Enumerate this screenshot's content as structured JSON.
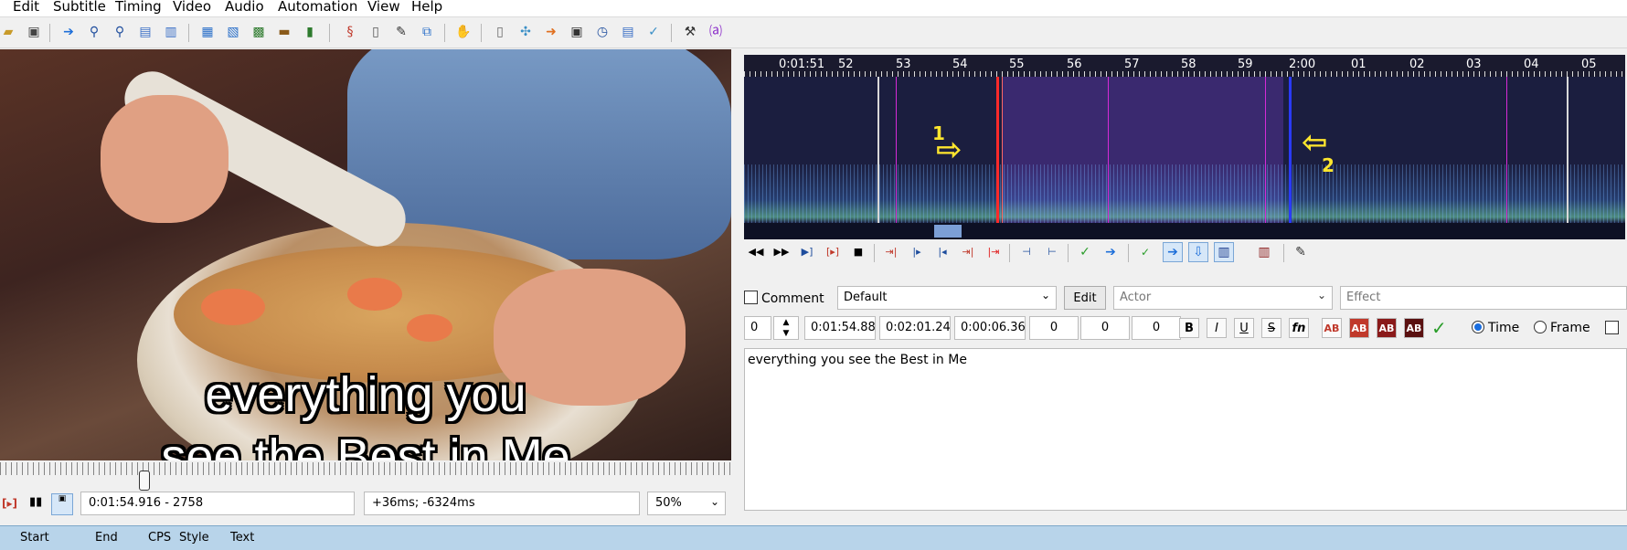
{
  "menu": [
    "Edit",
    "Subtitle",
    "Timing",
    "Video",
    "Audio",
    "Automation",
    "View",
    "Help"
  ],
  "toolbar_icons": [
    "open-icon",
    "save-icon",
    "jump-icon",
    "zoom-in-icon",
    "zoom-out-icon",
    "find-icon",
    "replace-icon",
    "copy-icon",
    "paste-icon",
    "video-icon",
    "keyframe-icon",
    "film-icon",
    "style-icon",
    "attach-icon",
    "fonts-icon",
    "spell-icon",
    "resample-icon",
    "translate-icon",
    "clock-icon",
    "settings-icon",
    "automation-icon"
  ],
  "video": {
    "subtitle_line1": "everything you",
    "subtitle_line2": "see the Best in Me",
    "time_frame": "0:01:54.916 - 2758",
    "offset": "+36ms; -6324ms",
    "zoom": "50%"
  },
  "audio": {
    "ruler_labels": [
      "0:01:51",
      "52",
      "53",
      "54",
      "55",
      "56",
      "57",
      "58",
      "59",
      "2:00",
      "01",
      "02",
      "03",
      "04",
      "05"
    ],
    "marker_1": "1",
    "marker_2": "2",
    "colors": {
      "selection": "#3b2a6e",
      "start_line": "#ff2a2a",
      "end_line": "#2a3aff",
      "keyframe_line": "#d62ad6"
    }
  },
  "editor": {
    "comment_label": "Comment",
    "style": "Default",
    "edit_button": "Edit",
    "actor_placeholder": "Actor",
    "effect_placeholder": "Effect",
    "layer": "0",
    "start_time": "0:01:54.88",
    "end_time": "0:02:01.24",
    "duration": "0:00:06.36",
    "margin_l": "0",
    "margin_r": "0",
    "margin_v": "0",
    "bold": "B",
    "italic": "I",
    "underline": "U",
    "strike": "S",
    "font": "fn",
    "color_labels": [
      "AB",
      "AB",
      "AB",
      "AB"
    ],
    "time_label": "Time",
    "frame_label": "Frame",
    "text": "everything you see the Best in Me"
  },
  "grid": {
    "columns": [
      "Start",
      "End",
      "CPS",
      "Style",
      "Text"
    ]
  }
}
